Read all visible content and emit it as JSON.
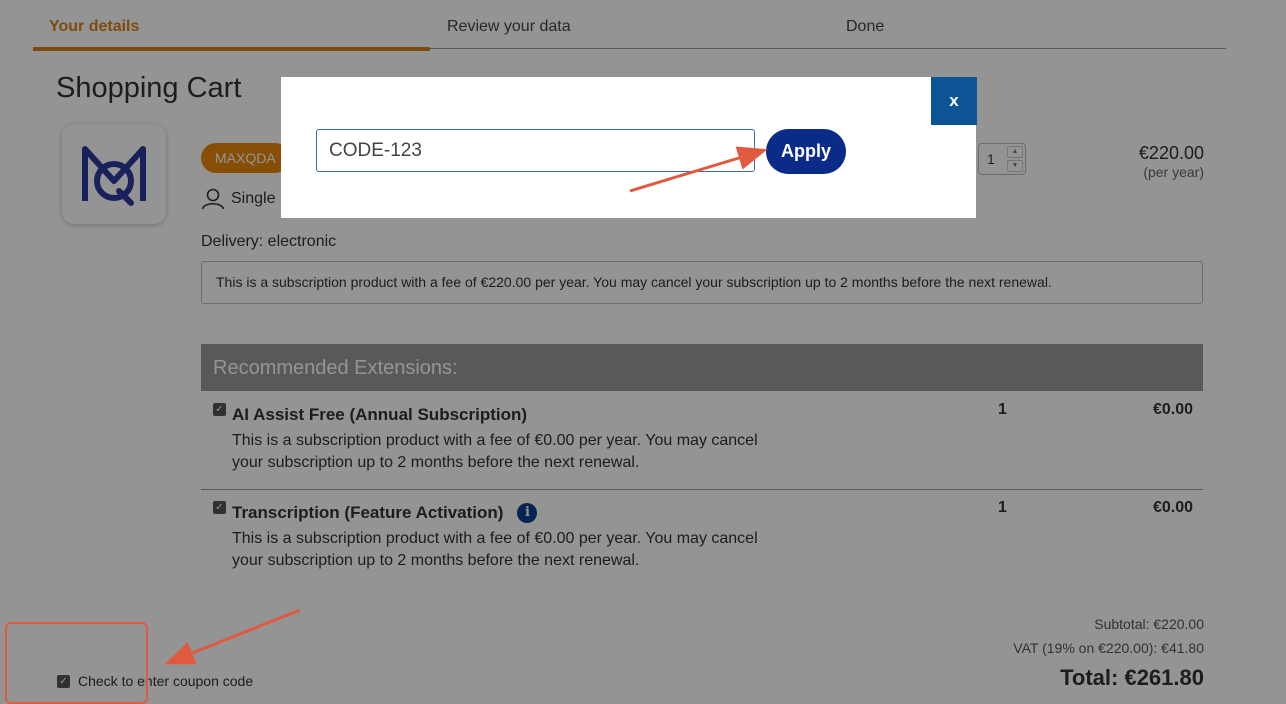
{
  "steps": [
    "Your details",
    "Review your data",
    "Done"
  ],
  "page_title": "Shopping Cart",
  "product": {
    "badge": "MAXQDA",
    "license": "Single",
    "quantity": "1",
    "price": "€220.00",
    "price_note": "(per year)",
    "delivery": "Delivery: electronic",
    "subscription_info": "This is a subscription product with a fee of €220.00 per year. You may cancel your subscription up to 2 months before the next renewal."
  },
  "recommended": {
    "header": "Recommended Extensions:",
    "items": [
      {
        "title": "AI Assist Free (Annual Subscription)",
        "desc": " This is a subscription product with a fee of €0.00 per year. You may cancel your subscription up to 2 months before the next renewal.",
        "qty": "1",
        "price": "€0.00"
      },
      {
        "title": "Transcription (Feature Activation)",
        "desc": " This is a subscription product with a fee of €0.00 per year. You may cancel your subscription up to 2 months before the next renewal.",
        "qty": "1",
        "price": "€0.00"
      }
    ]
  },
  "totals": {
    "subtotal": "Subtotal: €220.00",
    "vat": "VAT (19% on €220.00): €41.80",
    "total": "Total: €261.80"
  },
  "coupon_checkbox_label": "Check to enter coupon code",
  "modal": {
    "close_label": "x",
    "coupon_value": "CODE-123",
    "apply_label": "Apply"
  },
  "colors": {
    "accent_orange": "#d9821a",
    "apply_blue": "#0a2b88",
    "close_blue": "#0d5494",
    "annotation_red": "#e05a3f"
  }
}
